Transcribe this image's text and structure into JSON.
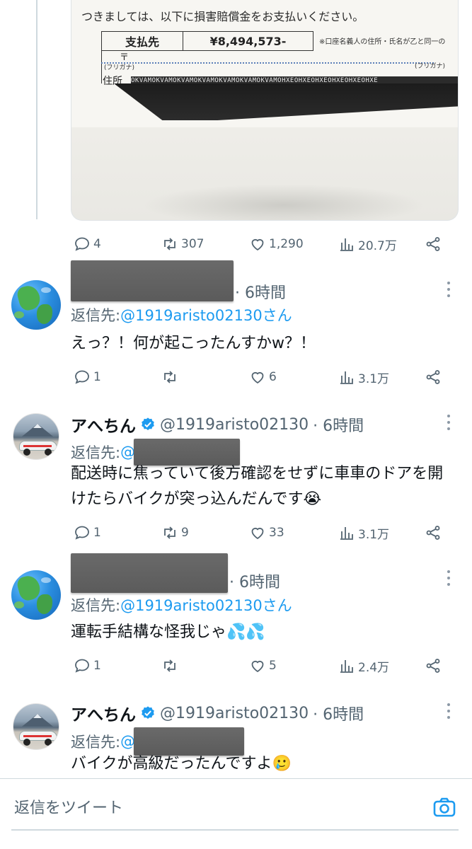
{
  "document_image": {
    "line1": "つきましては、以下に損害賠償金をお支払いください。",
    "payee_label": "支払先",
    "amount": "¥8,494,573-",
    "note": "※口座名義人の住所・氏名が乙と同一の",
    "postal": "〒",
    "furigana_left": "(フリガナ)",
    "furigana_right": "(フリガナ)",
    "address_label": "住所",
    "security_band": "OKVAMOKVAMOKVAMOKVAMOKVAMOKVAMOKVAMOHXEOHXEOHXEOHXEOHXEOHXE"
  },
  "tweets": [
    {
      "id": "original",
      "actions": {
        "replies": "4",
        "retweets": "307",
        "likes": "1,290",
        "views": "20.7万"
      }
    },
    {
      "id": "reply1",
      "time": "· 6時間",
      "reply_to_label": "返信先: ",
      "reply_to_handle": "@1919aristo02130さん",
      "text": "えっ？！何が起こったんすかw？！",
      "avatar": "globe-emoji",
      "actions": {
        "replies": "1",
        "retweets": "",
        "likes": "6",
        "views": "3.1万"
      }
    },
    {
      "id": "reply2",
      "name": "アへちん",
      "handle": "@1919aristo02130",
      "time": "· 6時間",
      "reply_to_label": "返信先: ",
      "reply_to_handle": "@",
      "text": "配送時に焦っていて後方確認をせずに車車のドアを開けたらバイクが突っ込んだんです😭",
      "avatar": "car-photo",
      "actions": {
        "replies": "1",
        "retweets": "9",
        "likes": "33",
        "views": "3.1万"
      }
    },
    {
      "id": "reply3",
      "time": "· 6時間",
      "reply_to_label": "返信先: ",
      "reply_to_handle": "@1919aristo02130さん",
      "text": "運転手結構な怪我じゃ💦💦",
      "avatar": "globe-emoji",
      "actions": {
        "replies": "1",
        "retweets": "",
        "likes": "5",
        "views": "2.4万"
      }
    },
    {
      "id": "reply4",
      "name": "アへちん",
      "handle": "@1919aristo02130",
      "time": "· 6時間",
      "reply_to_label": "返信先: ",
      "reply_to_handle": "@",
      "text": "バイクが高級だったんですよ🥲",
      "avatar": "car-photo"
    }
  ],
  "reply_bar": {
    "placeholder": "返信をツイート",
    "camera_icon": "camera-icon"
  },
  "colors": {
    "link": "#1d9bf0",
    "secondary_text": "#536471",
    "verified": "#1d9bf0",
    "divider": "#cfd9de"
  }
}
